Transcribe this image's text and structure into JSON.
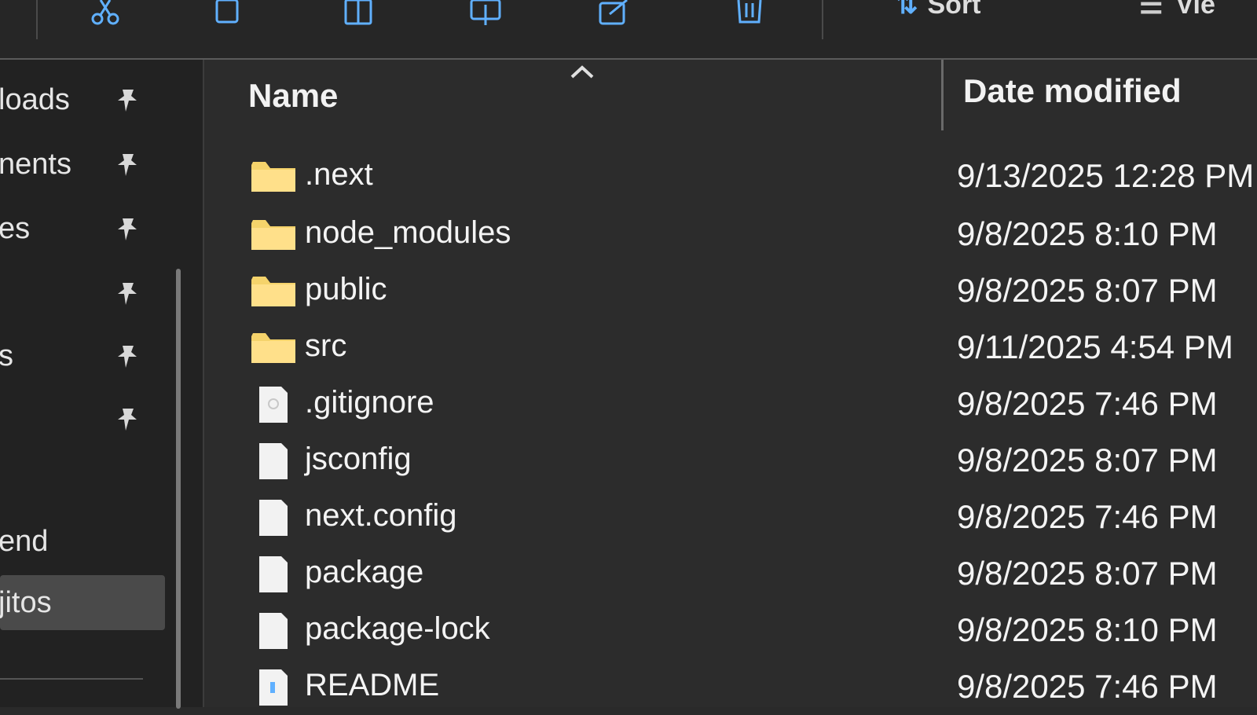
{
  "toolbar": {
    "sort_label": "Sort",
    "view_label": "Vie",
    "icons": [
      "cut-icon",
      "copy-icon",
      "paste-icon",
      "rename-icon",
      "share-icon",
      "delete-icon"
    ]
  },
  "sidebar": {
    "items": [
      {
        "label": "loads",
        "pinned": true
      },
      {
        "label": "nents",
        "pinned": true
      },
      {
        "label": "es",
        "pinned": true
      },
      {
        "label": "",
        "pinned": true
      },
      {
        "label": "s",
        "pinned": true
      },
      {
        "label": "",
        "pinned": true
      },
      {
        "label": "end",
        "pinned": false
      },
      {
        "label": "jitos",
        "pinned": false,
        "selected": true
      }
    ]
  },
  "list": {
    "columns": {
      "name": "Name",
      "date": "Date modified"
    },
    "rows": [
      {
        "name": ".next",
        "date": "9/13/2025 12:28 PM",
        "type": "folder"
      },
      {
        "name": "node_modules",
        "date": "9/8/2025 8:10 PM",
        "type": "folder"
      },
      {
        "name": "public",
        "date": "9/8/2025 8:07 PM",
        "type": "folder"
      },
      {
        "name": "src",
        "date": "9/11/2025 4:54 PM",
        "type": "folder"
      },
      {
        "name": ".gitignore",
        "date": "9/8/2025 7:46 PM",
        "type": "file"
      },
      {
        "name": "jsconfig",
        "date": "9/8/2025 8:07 PM",
        "type": "file"
      },
      {
        "name": "next.config",
        "date": "9/8/2025 7:46 PM",
        "type": "file"
      },
      {
        "name": "package",
        "date": "9/8/2025 8:07 PM",
        "type": "file"
      },
      {
        "name": "package-lock",
        "date": "9/8/2025 8:10 PM",
        "type": "file"
      },
      {
        "name": "README",
        "date": "9/8/2025 7:46 PM",
        "type": "file"
      }
    ]
  },
  "colors": {
    "folder": "#f5d36b",
    "file": "#f2f2f2",
    "accent": "#60b0ff"
  }
}
